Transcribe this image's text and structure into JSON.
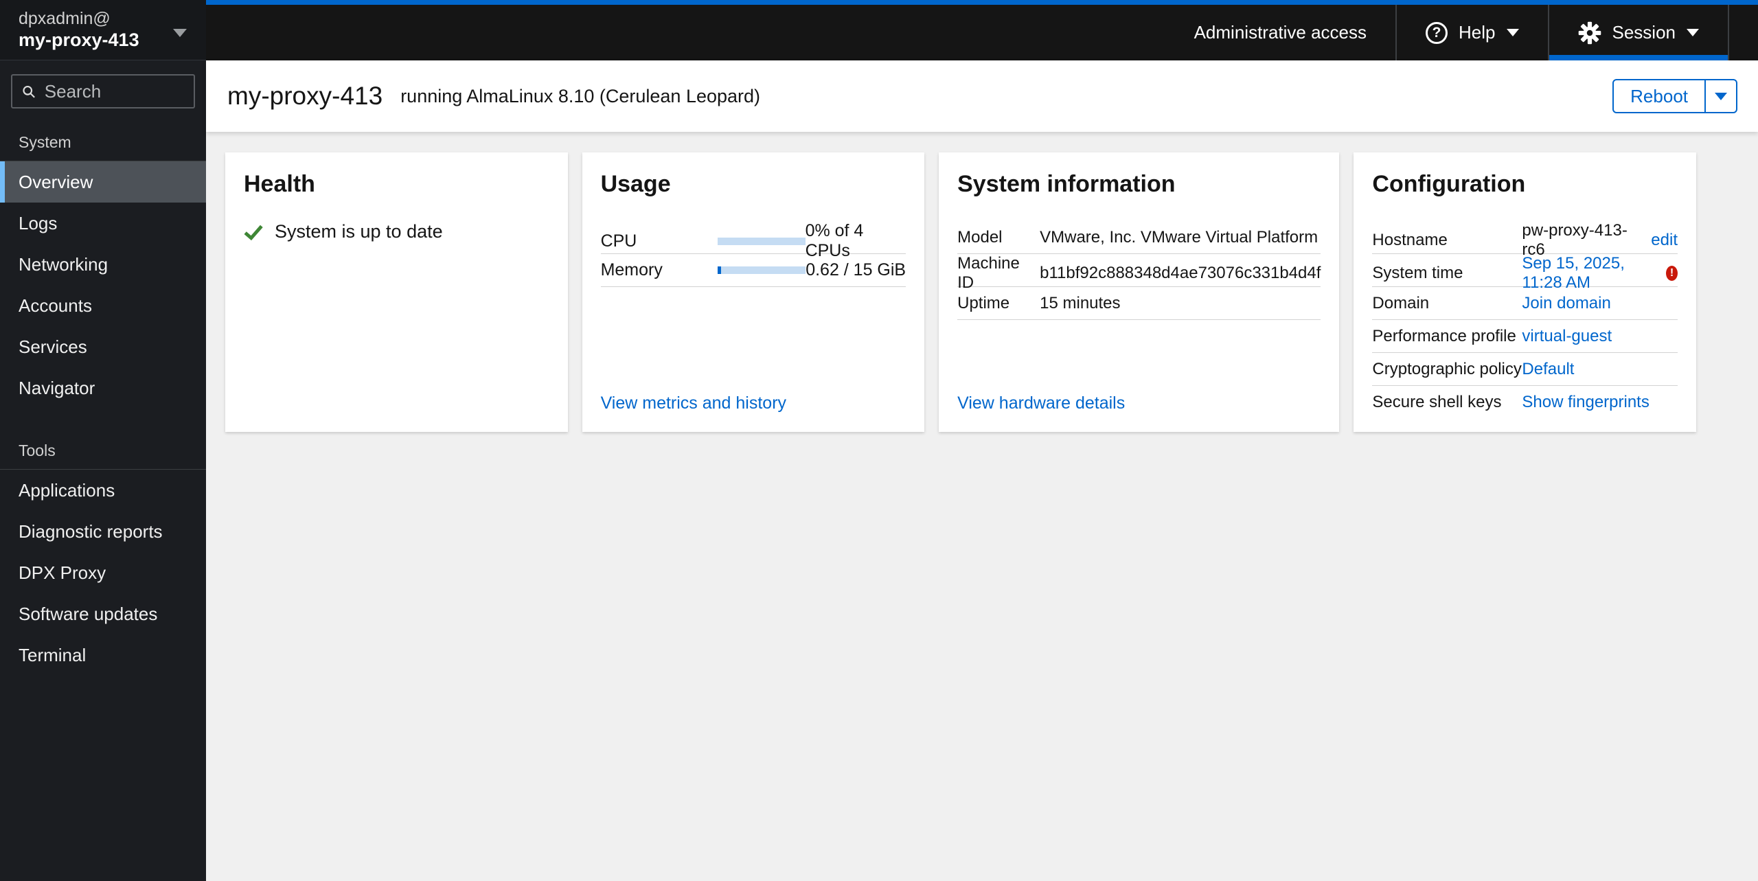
{
  "masthead": {
    "admin_access_label": "Administrative access",
    "help_label": "Help",
    "session_label": "Session"
  },
  "sidebar": {
    "user": "dpxadmin@",
    "host": "my-proxy-413",
    "search_placeholder": "Search",
    "sections": [
      {
        "label": "System",
        "items": [
          {
            "label": "Overview",
            "selected": true
          },
          {
            "label": "Logs"
          },
          {
            "label": "Networking"
          },
          {
            "label": "Accounts"
          },
          {
            "label": "Services"
          },
          {
            "label": "Navigator"
          }
        ]
      },
      {
        "label": "Tools",
        "items": [
          {
            "label": "Applications"
          },
          {
            "label": "Diagnostic reports"
          },
          {
            "label": "DPX Proxy"
          },
          {
            "label": "Software updates"
          },
          {
            "label": "Terminal"
          }
        ]
      }
    ]
  },
  "page_header": {
    "title": "my-proxy-413",
    "subtitle": "running AlmaLinux 8.10 (Cerulean Leopard)",
    "reboot_label": "Reboot"
  },
  "cards": {
    "health": {
      "title": "Health",
      "status": "System is up to date"
    },
    "usage": {
      "title": "Usage",
      "rows": [
        {
          "label": "CPU",
          "value": "0% of 4 CPUs",
          "percent": 0
        },
        {
          "label": "Memory",
          "value": "0.62 / 15 GiB",
          "percent": 4.1
        }
      ],
      "link": "View metrics and history"
    },
    "system_information": {
      "title": "System information",
      "rows": [
        {
          "label": "Model",
          "value": "VMware, Inc. VMware Virtual Platform"
        },
        {
          "label": "Machine ID",
          "value": "b11bf92c888348d4ae73076c331b4d4f"
        },
        {
          "label": "Uptime",
          "value": "15 minutes"
        }
      ],
      "link": "View hardware details"
    },
    "configuration": {
      "title": "Configuration",
      "rows": [
        {
          "label": "Hostname",
          "text": "pw-proxy-413-rc6",
          "link": "edit"
        },
        {
          "label": "System time",
          "link": "Sep 15, 2025, 11:28 AM",
          "warning": true
        },
        {
          "label": "Domain",
          "link": "Join domain"
        },
        {
          "label": "Performance profile",
          "link": "virtual-guest"
        },
        {
          "label": "Cryptographic policy",
          "link": "Default"
        },
        {
          "label": "Secure shell keys",
          "link": "Show fingerprints"
        }
      ]
    }
  },
  "icons": {
    "help_glyph": "?",
    "warning_glyph": "!"
  },
  "colors": {
    "accent_blue": "#0066cc",
    "sidebar_selected_accent": "#73bcf7",
    "success_green": "#3e8635",
    "danger_red": "#c9190b",
    "progress_track": "#c5dcf3",
    "masthead_bg": "#151515",
    "sidebar_bg": "#1b1d21",
    "content_bg": "#f0f0f0"
  }
}
